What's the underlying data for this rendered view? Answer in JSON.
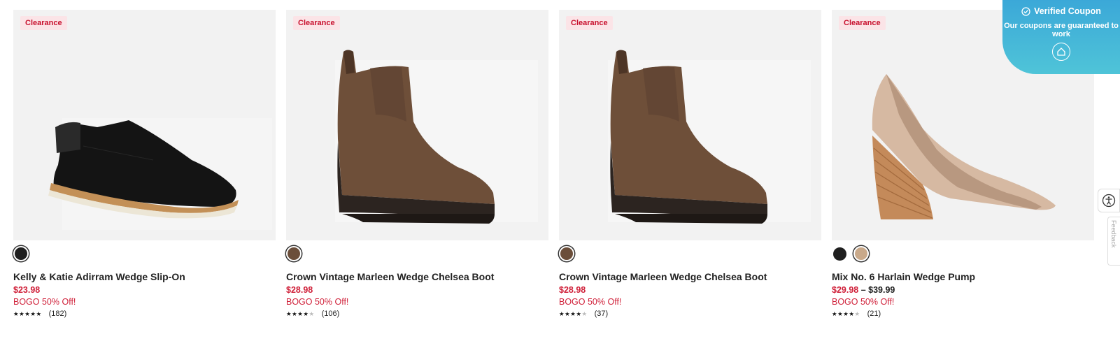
{
  "products": [
    {
      "badge": "Clearance",
      "image": "black-slip-on-shoe",
      "swatches": [
        {
          "color": "#1f1f1f",
          "selected": true
        }
      ],
      "name": "Kelly & Katie Adirram Wedge Slip-On",
      "price": "$23.98",
      "price_high": "",
      "promo": "BOGO 50% Off!",
      "stars": "★★★★★",
      "stars_empty": "",
      "rating": 5,
      "reviews": "(182)"
    },
    {
      "badge": "Clearance",
      "image": "brown-wedge-chelsea-boot",
      "swatches": [
        {
          "color": "#6b4e3a",
          "selected": true
        }
      ],
      "name": "Crown Vintage Marleen Wedge Chelsea Boot",
      "price": "$28.98",
      "price_high": "",
      "promo": "BOGO 50% Off!",
      "stars": "★★★★",
      "stars_empty": "★",
      "rating": 4,
      "reviews": "(106)"
    },
    {
      "badge": "Clearance",
      "image": "brown-wedge-chelsea-boot",
      "swatches": [
        {
          "color": "#6b4e3a",
          "selected": true
        }
      ],
      "name": "Crown Vintage Marleen Wedge Chelsea Boot",
      "price": "$28.98",
      "price_high": "",
      "promo": "BOGO 50% Off!",
      "stars": "★★★★",
      "stars_empty": "★",
      "rating": 4,
      "reviews": "(37)"
    },
    {
      "badge": "Clearance",
      "image": "tan-wedge-pump",
      "swatches": [
        {
          "color": "#1f1f1f",
          "selected": false
        },
        {
          "color": "#c9a98a",
          "selected": true
        }
      ],
      "name": "Mix No. 6 Harlain Wedge Pump",
      "price": "$29.98",
      "price_dash": "–",
      "price_high": "$39.99",
      "promo": "BOGO 50% Off!",
      "stars": "★★★★",
      "stars_empty": "★",
      "rating": 4,
      "reviews": "(21)"
    }
  ],
  "coupon": {
    "title": "Verified Coupon",
    "subtitle": "Our coupons are guaranteed to work",
    "icon": "home-shield-icon"
  },
  "side_widgets": {
    "accessibility_icon": "accessibility-icon",
    "feedback_label": "Feedback"
  },
  "colors": {
    "sale_red": "#d0213a",
    "badge_bg": "#fbe4e7",
    "coupon_gradient_start": "#3ba8d8",
    "coupon_gradient_end": "#4fc4d8"
  }
}
